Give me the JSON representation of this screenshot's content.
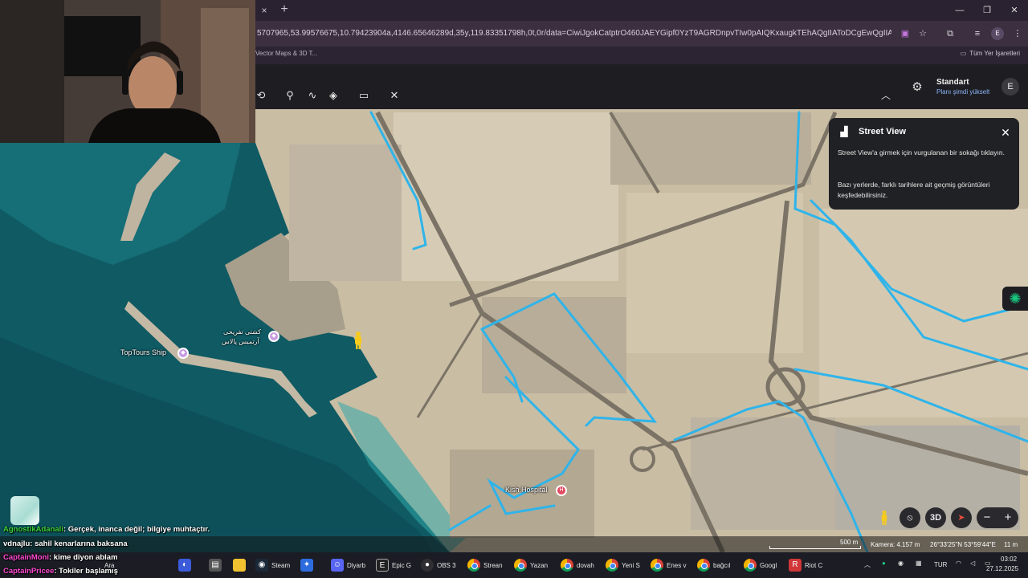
{
  "browser": {
    "url": "5707965,53.99576675,10.79423904a,4146.65646289d,35y,119.83351798h,0t,0r/data=CiwiJgokCatptrO460JAEYGipf0YzT9AGRDnpvTIw0pAIQKxaugkTEhAQgIIAToDCgEwQgIIAEoNCP_______",
    "bookmark_left": "Vector Maps & 3D T...",
    "bookmark_right": "Tüm Yer İşaretleri",
    "profile_letter": "E",
    "tab_close": "×",
    "tab_new": "+"
  },
  "earth": {
    "plan_name": "Standart",
    "plan_upgrade": "Planı şimdi yükselt",
    "avatar_letter": "E",
    "tools": [
      "history-icon",
      "pin-icon",
      "path-icon",
      "layers-icon",
      "ruler-icon",
      "tools-icon"
    ]
  },
  "street_view": {
    "title": "Street View",
    "text1": "Street View'a girmek için vurgulanan bir sokağı tıklayın.",
    "text2": "Bazı yerlerde, farklı tarihlere ait geçmiş görüntüleri keşfedebilirsiniz."
  },
  "map": {
    "labels": {
      "toptours": "TopTours Ship",
      "arabic_line1": "کشتی تفریحی",
      "arabic_line2": "آرتمیس پالاس",
      "hospital": "Kish Hospital"
    },
    "controls": {
      "three_d": "3D",
      "scale": "500 m",
      "camera": "Kamera: 4.157 m",
      "coords": "26°33'25\"N 53°59'44\"E",
      "altitude": "11 m"
    },
    "colors": {
      "water": "#0f5a63",
      "land": "#c9bda4",
      "streetview": "#2fb4ea"
    }
  },
  "chat": {
    "messages": [
      {
        "user": "AgnostikAdanali",
        "user_color": "#3cd33c",
        "text": ": Gerçek, inanca değil; bilgiye muhtaçtır."
      },
      {
        "user": "vdnajlu",
        "user_color": "#ffffff",
        "text": ": sahil kenarlarına baksana"
      },
      {
        "user": "CaptainMoni",
        "user_color": "#ff4ad2",
        "text": ": kime diyon ablam"
      },
      {
        "user": "CaptainPricee",
        "user_color": "#ff4ad2",
        "text": ": Tokiler başlamış"
      }
    ]
  },
  "taskbar": {
    "items": [
      {
        "name": "steam",
        "label": "Steam"
      },
      {
        "name": "discord",
        "label": "Diyarb"
      },
      {
        "name": "epic",
        "label": "Epic G"
      },
      {
        "name": "obs",
        "label": "OBS 3"
      },
      {
        "name": "chrome-stream",
        "label": "Strean"
      },
      {
        "name": "chrome-yazan",
        "label": "Yazan"
      },
      {
        "name": "chrome-dovah",
        "label": "dovah"
      },
      {
        "name": "chrome-yeni",
        "label": "Yeni S"
      },
      {
        "name": "chrome-enes",
        "label": "Enes v"
      },
      {
        "name": "chrome-bagcil",
        "label": "bağcıl"
      },
      {
        "name": "chrome-google",
        "label": "Googl"
      },
      {
        "name": "riot",
        "label": "Riot C"
      }
    ],
    "search": "Ara",
    "lang": "TUR",
    "time": "03:02",
    "date": "27.12.2025"
  }
}
